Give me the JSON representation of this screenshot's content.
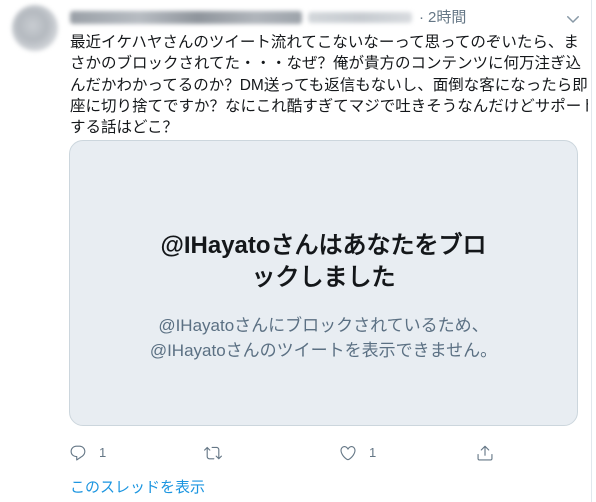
{
  "header": {
    "time_separator": "·",
    "time": "2時間"
  },
  "tweet": {
    "text_lines": [
      "最近イケハヤさんのツイート流れてこないなーって思ってのぞいたら、ま",
      "さかのブロックされてた・・・なぜ？俺が貴方のコンテンツに何万注ぎ込",
      "んだかわかってるのか？DM送っても返信もないし、面倒な客になったら即",
      "座に切り捨てですか？なにこれ酷すぎてマジで吐きそうなんだけどサポート",
      "する話はどこ？"
    ]
  },
  "blocked_card": {
    "title_lines": [
      "@IHayatoさんはあなたをブロ",
      "ックしました"
    ],
    "message_lines": [
      "@IHayatoさんにブロックされているため、",
      "@IHayatoさんのツイートを表示できません。"
    ]
  },
  "actions": {
    "reply_count": "1",
    "like_count": "1"
  },
  "thread_link": "このスレッドを表示",
  "icons": {
    "caret": "chevron-down-icon",
    "reply": "reply-icon",
    "retweet": "retweet-icon",
    "like": "heart-icon",
    "share": "share-icon"
  },
  "colors": {
    "text": "#14171a",
    "muted": "#657786",
    "link": "#1b95e0",
    "card_background": "#e8edf2",
    "card_border": "#ccd6dd"
  }
}
